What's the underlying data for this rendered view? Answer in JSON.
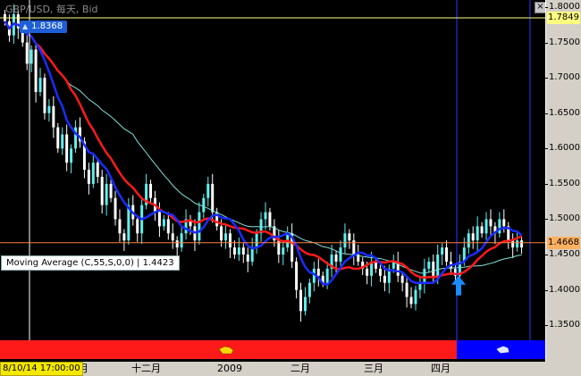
{
  "window": {
    "title": "GBP/USD, 每天, Bid",
    "close_glyph": "×"
  },
  "labels": {
    "high_price": "1.8368",
    "moving_average": "Moving Average (C,55,S,0,0) | 1.4423",
    "current_price": "1.4668",
    "resistance_price": "1.7849",
    "cursor_date": "8/10/14 17:00:00"
  },
  "price_axis": {
    "ticks": [
      "1.8000",
      "1.7500",
      "1.7000",
      "1.6500",
      "1.6000",
      "1.5500",
      "1.5000",
      "1.4500",
      "1.4000",
      "1.3500"
    ]
  },
  "time_axis": {
    "labels": [
      "月",
      "十二月",
      "2009",
      "二月",
      "三月",
      "四月"
    ]
  },
  "colors": {
    "background": "#000000",
    "up_candle": "#5ff0f0",
    "down_candle": "#ffffff",
    "ma_fast": "#1a2cff",
    "ma_mid": "#ff1a1a",
    "ma_slow": "#7fe0d8",
    "bear_zone": "#ff1a1a",
    "bull_zone": "#0000ff",
    "current_price_box": "#ffb060",
    "resistance_box": "#ffff80"
  },
  "icons": {
    "bear_zone": "bear-icon",
    "bull_zone": "bull-icon",
    "signal": "up-arrow-icon"
  },
  "chart_data": {
    "type": "candlestick",
    "instrument": "GBP/USD",
    "ylim": [
      1.33,
      1.8
    ],
    "date_range": [
      "2008-10-14",
      "2009-04-30"
    ],
    "start_date": "2008-10-14",
    "closes": [
      1.78,
      1.76,
      1.79,
      1.77,
      1.75,
      1.72,
      1.74,
      1.68,
      1.7,
      1.65,
      1.66,
      1.63,
      1.6,
      1.62,
      1.58,
      1.6,
      1.63,
      1.61,
      1.57,
      1.55,
      1.58,
      1.56,
      1.52,
      1.55,
      1.53,
      1.5,
      1.48,
      1.47,
      1.52,
      1.5,
      1.48,
      1.52,
      1.55,
      1.53,
      1.51,
      1.49,
      1.5,
      1.48,
      1.47,
      1.46,
      1.48,
      1.5,
      1.49,
      1.47,
      1.51,
      1.53,
      1.55,
      1.51,
      1.49,
      1.47,
      1.48,
      1.46,
      1.45,
      1.46,
      1.45,
      1.44,
      1.46,
      1.48,
      1.5,
      1.51,
      1.49,
      1.47,
      1.45,
      1.46,
      1.48,
      1.44,
      1.4,
      1.37,
      1.39,
      1.41,
      1.43,
      1.42,
      1.41,
      1.43,
      1.45,
      1.44,
      1.46,
      1.48,
      1.47,
      1.45,
      1.44,
      1.43,
      1.42,
      1.44,
      1.43,
      1.42,
      1.41,
      1.43,
      1.44,
      1.42,
      1.41,
      1.39,
      1.38,
      1.4,
      1.41,
      1.43,
      1.44,
      1.42,
      1.45,
      1.46,
      1.44,
      1.43,
      1.42,
      1.44,
      1.46,
      1.48,
      1.47,
      1.49,
      1.48,
      1.5,
      1.49,
      1.48,
      1.5,
      1.49,
      1.47,
      1.46,
      1.47,
      1.46
    ],
    "up_arrow_at": 1.42,
    "vertical_markers": [
      "2009-04-01",
      "2009-04-29"
    ],
    "horizontal_levels": [
      1.8368,
      1.7849,
      1.4668
    ],
    "moving_averages": [
      {
        "name": "Moving Average (C,55,S,0,0)",
        "last": 1.4423
      }
    ]
  }
}
